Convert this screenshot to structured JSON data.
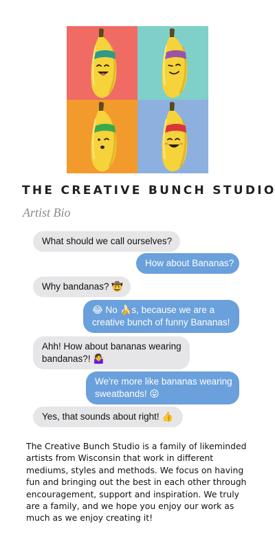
{
  "artwork": {
    "panels": [
      {
        "background": "#ef6b63",
        "bandana": "#2f9a8a"
      },
      {
        "background": "#7fd0c9",
        "bandana": "#9a54a7"
      },
      {
        "background": "#f39a2c",
        "bandana": "#3aa94c"
      },
      {
        "background": "#8db0de",
        "bandana": "#d8363a"
      }
    ]
  },
  "header": {
    "title": "THE CREATIVE BUNCH STUDIO",
    "subtitle": "Artist Bio"
  },
  "chat": {
    "messages": [
      {
        "side": "left",
        "lines": [
          "What should we call ourselves?"
        ]
      },
      {
        "side": "right",
        "lines": [
          "How about Bananas?"
        ]
      },
      {
        "side": "left",
        "lines": [
          "Why bandanas? 🤠"
        ]
      },
      {
        "side": "right",
        "lines": [
          "😂 No 🍌s, because we are a",
          "creative bunch of funny Bananas!"
        ]
      },
      {
        "side": "left",
        "lines": [
          "Ahh! How about bananas wearing",
          "bandanas?! 🤷‍♀️"
        ]
      },
      {
        "side": "right",
        "lines": [
          "We're more like bananas wearing",
          "sweatbands! 😝"
        ]
      },
      {
        "side": "left",
        "lines": [
          "Yes, that sounds about right! 👍"
        ]
      }
    ]
  },
  "bio": {
    "lines": [
      "The Creative Bunch Studio is a family of likeminded",
      "artists from Wisconsin that work in different",
      "mediums, styles and methods. We focus on having",
      "fun and bringing out the best in each other through",
      "encouragement, support and inspiration. We truly",
      "are a family, and we hope you enjoy our work as",
      "much as we enjoy creating it!"
    ]
  }
}
